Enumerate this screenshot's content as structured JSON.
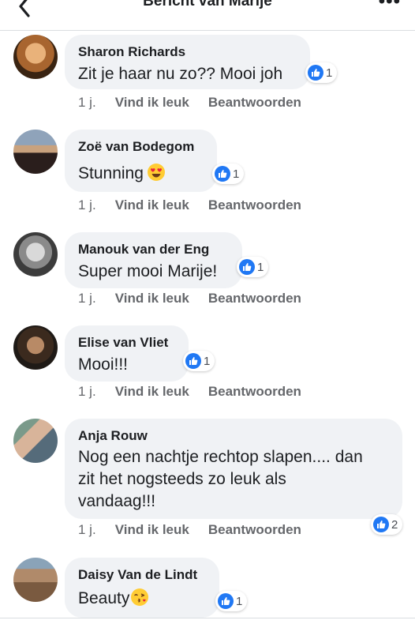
{
  "header": {
    "title": "Bericht van Marije",
    "more": "•••"
  },
  "colors": {
    "like_blue": "#2078f4",
    "bubble_bg": "#f0f2f5",
    "meta_gray": "#65676b"
  },
  "comments": [
    {
      "name": "Sharon Richards",
      "text": "Zit je haar nu zo?? Mooi joh",
      "likes": "1",
      "time": "1 j.",
      "like_label": "Vind ik leuk",
      "reply_label": "Beantwoorden"
    },
    {
      "name": "Zoë van Bodegom",
      "text": "Stunning",
      "emoji": "heart-eyes-emoji",
      "likes": "1",
      "time": "1 j.",
      "like_label": "Vind ik leuk",
      "reply_label": "Beantwoorden"
    },
    {
      "name": "Manouk van der Eng",
      "text": "Super mooi Marije!",
      "likes": "1",
      "time": "1 j.",
      "like_label": "Vind ik leuk",
      "reply_label": "Beantwoorden"
    },
    {
      "name": "Elise van Vliet",
      "text": "Mooi!!!",
      "likes": "1",
      "time": "1 j.",
      "like_label": "Vind ik leuk",
      "reply_label": "Beantwoorden"
    },
    {
      "name": "Anja Rouw",
      "text_lines": [
        "Nog een nachtje rechtop slapen.... dan",
        "zit het nogsteeds zo leuk als",
        "vandaag!!!"
      ],
      "likes": "2",
      "time": "1 j.",
      "like_label": "Vind ik leuk",
      "reply_label": "Beantwoorden"
    },
    {
      "name": "Daisy Van de Lindt",
      "text": "Beauty",
      "emoji": "kiss-emoji",
      "likes": "1"
    }
  ]
}
